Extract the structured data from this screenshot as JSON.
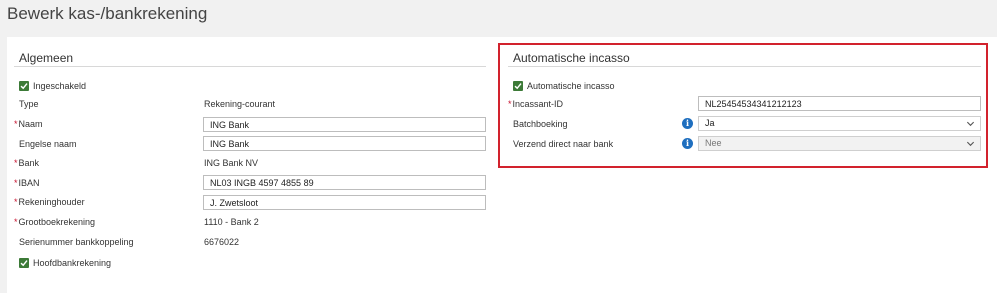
{
  "page": {
    "title": "Bewerk kas-/bankrekening"
  },
  "algemeen": {
    "section_title": "Algemeen",
    "ingeschakeld": {
      "label": "Ingeschakeld",
      "checked": true
    },
    "type": {
      "label": "Type",
      "value": "Rekening-courant"
    },
    "naam": {
      "label": "Naam",
      "required": true,
      "value": "ING Bank"
    },
    "engelse_naam": {
      "label": "Engelse naam",
      "value": "ING Bank"
    },
    "bank": {
      "label": "Bank",
      "required": true,
      "value": "ING Bank NV"
    },
    "iban": {
      "label": "IBAN",
      "required": true,
      "value": "NL03 INGB 4597 4855 89"
    },
    "rekeninghouder": {
      "label": "Rekeninghouder",
      "required": true,
      "value": "J. Zwetsloot"
    },
    "grootboekrekening": {
      "label": "Grootboekrekening",
      "required": true,
      "value": "1110 - Bank 2"
    },
    "serienummer": {
      "label": "Serienummer bankkoppeling",
      "value": "6676022"
    },
    "hoofdbankrekening": {
      "label": "Hoofdbankrekening",
      "checked": true
    }
  },
  "incasso": {
    "section_title": "Automatische incasso",
    "automatische_incasso": {
      "label": "Automatische incasso",
      "checked": true
    },
    "incassant_id": {
      "label": "Incassant-ID",
      "required": true,
      "value": "NL25454534341212123"
    },
    "batchboeking": {
      "label": "Batchboeking",
      "value": "Ja"
    },
    "verzend_direct": {
      "label": "Verzend direct naar bank",
      "value": "Nee",
      "disabled": true
    }
  },
  "icons": {
    "info": "info-icon",
    "chevron": "chevron-down-icon",
    "check": "check-icon"
  },
  "colors": {
    "accent_green": "#3c7a37",
    "required_red": "#c8102e",
    "info_blue": "#1f6fbf",
    "highlight_red": "#d2222d"
  }
}
